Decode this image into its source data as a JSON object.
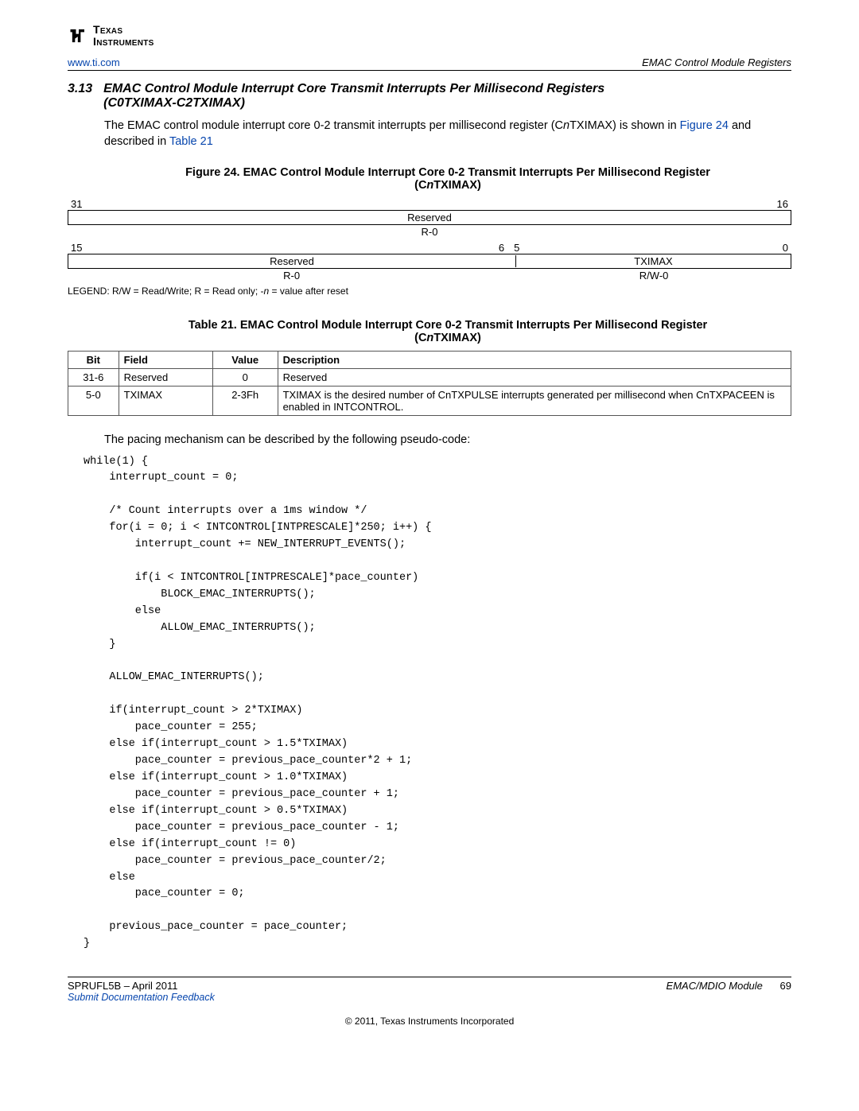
{
  "logo": {
    "company_line1": "Texas",
    "company_line2": "Instruments"
  },
  "header": {
    "url": "www.ti.com",
    "chapter": "EMAC Control Module Registers"
  },
  "section": {
    "number": "3.13",
    "title_line1": "EMAC Control Module Interrupt Core Transmit Interrupts Per Millisecond Registers",
    "title_line2": "(C0TXIMAX-C2TXIMAX)"
  },
  "intro": {
    "pre": "The EMAC control module interrupt core 0-2 transmit interrupts per millisecond register (C",
    "italic1": "n",
    "mid1": "TXIMAX) is shown in ",
    "fig_link": "Figure 24",
    "mid2": " and described in ",
    "tbl_link": "Table 21"
  },
  "figure": {
    "caption_a": "Figure 24. EMAC Control Module Interrupt Core 0-2 Transmit Interrupts Per Millisecond Register",
    "caption_b_pre": "(C",
    "caption_b_italic": "n",
    "caption_b_post": "TXIMAX)",
    "bits_hi_left": "31",
    "bits_hi_right": "16",
    "row1_field": "Reserved",
    "row1_rw": "R-0",
    "bits_lo_a": "15",
    "bits_lo_b": "6",
    "bits_lo_c": "5",
    "bits_lo_d": "0",
    "row2_left_field": "Reserved",
    "row2_right_field": "TXIMAX",
    "row2_left_rw": "R-0",
    "row2_right_rw": "R/W-0"
  },
  "legend": {
    "pre": "LEGEND: R/W = Read/Write; R = Read only; -",
    "italic": "n",
    "post": " = value after reset"
  },
  "table": {
    "caption_a": "Table 21. EMAC Control Module Interrupt Core 0-2 Transmit Interrupts Per Millisecond Register",
    "caption_b_pre": "(C",
    "caption_b_italic": "n",
    "caption_b_post": "TXIMAX)",
    "headers": {
      "bit": "Bit",
      "field": "Field",
      "value": "Value",
      "description": "Description"
    },
    "rows": [
      {
        "bit": "31-6",
        "field": "Reserved",
        "value": "0",
        "description": "Reserved"
      },
      {
        "bit": "5-0",
        "field": "TXIMAX",
        "value": "2-3Fh",
        "description": "TXIMAX is the desired number of CnTXPULSE interrupts generated per millisecond when CnTXPACEEN is enabled in INTCONTROL."
      }
    ]
  },
  "pseudo_intro": "The pacing mechanism can be described by the following pseudo-code:",
  "code": "while(1) {\n    interrupt_count = 0;\n\n    /* Count interrupts over a 1ms window */\n    for(i = 0; i < INTCONTROL[INTPRESCALE]*250; i++) {\n        interrupt_count += NEW_INTERRUPT_EVENTS();\n\n        if(i < INTCONTROL[INTPRESCALE]*pace_counter)\n            BLOCK_EMAC_INTERRUPTS();\n        else\n            ALLOW_EMAC_INTERRUPTS();\n    }\n\n    ALLOW_EMAC_INTERRUPTS();\n\n    if(interrupt_count > 2*TXIMAX)\n        pace_counter = 255;\n    else if(interrupt_count > 1.5*TXIMAX)\n        pace_counter = previous_pace_counter*2 + 1;\n    else if(interrupt_count > 1.0*TXIMAX)\n        pace_counter = previous_pace_counter + 1;\n    else if(interrupt_count > 0.5*TXIMAX)\n        pace_counter = previous_pace_counter - 1;\n    else if(interrupt_count != 0)\n        pace_counter = previous_pace_counter/2;\n    else\n        pace_counter = 0;\n\n    previous_pace_counter = pace_counter;\n}",
  "footer": {
    "docid_date": "SPRUFL5B – April 2011",
    "module": "EMAC/MDIO Module",
    "page": "69",
    "feedback": "Submit Documentation Feedback",
    "copyright": "© 2011, Texas Instruments Incorporated"
  }
}
